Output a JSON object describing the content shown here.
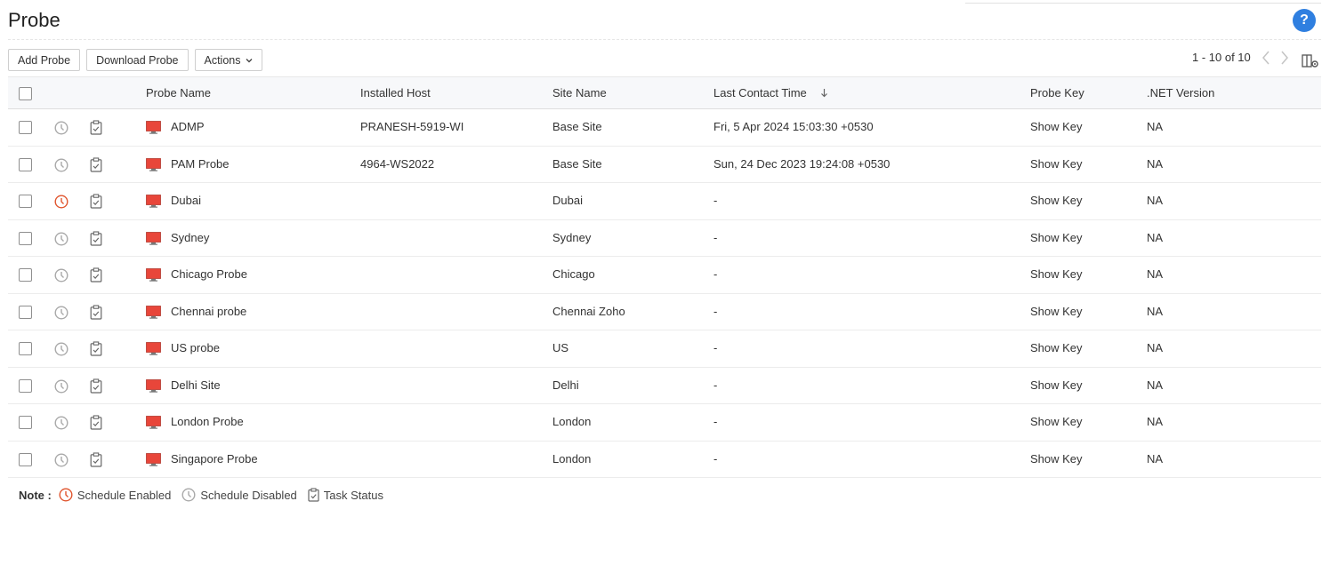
{
  "page": {
    "title": "Probe",
    "help_label": "?"
  },
  "toolbar": {
    "add_probe": "Add Probe",
    "download_probe": "Download Probe",
    "actions": "Actions"
  },
  "pager": {
    "range_text": "1 - 10 of 10"
  },
  "table": {
    "headers": {
      "probe_name": "Probe Name",
      "installed_host": "Installed Host",
      "site_name": "Site Name",
      "last_contact_time": "Last Contact Time",
      "probe_key": "Probe Key",
      "net_version": ".NET Version"
    },
    "sort": {
      "column": "last_contact_time",
      "direction": "descending"
    },
    "rows": [
      {
        "name": "ADMP",
        "host": "PRANESH-5919-WI",
        "site": "Base Site",
        "last_contact": "Fri, 5 Apr 2024 15:03:30 +0530",
        "key": "Show Key",
        "net": "NA",
        "schedule": "disabled"
      },
      {
        "name": "PAM Probe",
        "host": "4964-WS2022",
        "site": "Base Site",
        "last_contact": "Sun, 24 Dec 2023 19:24:08 +0530",
        "key": "Show Key",
        "net": "NA",
        "schedule": "disabled"
      },
      {
        "name": "Dubai",
        "host": "",
        "site": "Dubai",
        "last_contact": "-",
        "key": "Show Key",
        "net": "NA",
        "schedule": "enabled"
      },
      {
        "name": "Sydney",
        "host": "",
        "site": "Sydney",
        "last_contact": "-",
        "key": "Show Key",
        "net": "NA",
        "schedule": "disabled"
      },
      {
        "name": "Chicago Probe",
        "host": "",
        "site": "Chicago",
        "last_contact": "-",
        "key": "Show Key",
        "net": "NA",
        "schedule": "disabled"
      },
      {
        "name": "Chennai probe",
        "host": "",
        "site": "Chennai Zoho",
        "last_contact": "-",
        "key": "Show Key",
        "net": "NA",
        "schedule": "disabled"
      },
      {
        "name": "US probe",
        "host": "",
        "site": "US",
        "last_contact": "-",
        "key": "Show Key",
        "net": "NA",
        "schedule": "disabled"
      },
      {
        "name": "Delhi Site",
        "host": "",
        "site": "Delhi",
        "last_contact": "-",
        "key": "Show Key",
        "net": "NA",
        "schedule": "disabled"
      },
      {
        "name": "London Probe",
        "host": "",
        "site": "London",
        "last_contact": "-",
        "key": "Show Key",
        "net": "NA",
        "schedule": "disabled"
      },
      {
        "name": "Singapore Probe",
        "host": "",
        "site": "London",
        "last_contact": "-",
        "key": "Show Key",
        "net": "NA",
        "schedule": "disabled"
      }
    ]
  },
  "note": {
    "label": "Note :",
    "schedule_enabled": "Schedule Enabled",
    "schedule_disabled": "Schedule Disabled",
    "task_status": "Task Status"
  },
  "colors": {
    "schedule_enabled": "#e0552e",
    "schedule_disabled": "#a9a9a9",
    "probe_icon": "#e8463a",
    "help": "#2f7fe0"
  },
  "icons": {
    "schedule": "clock-icon",
    "task": "clipboard-check-icon",
    "probe": "monitor-icon",
    "sort": "arrow-down-icon",
    "prev": "chevron-left-icon",
    "next": "chevron-right-icon",
    "columns": "column-settings-icon"
  }
}
